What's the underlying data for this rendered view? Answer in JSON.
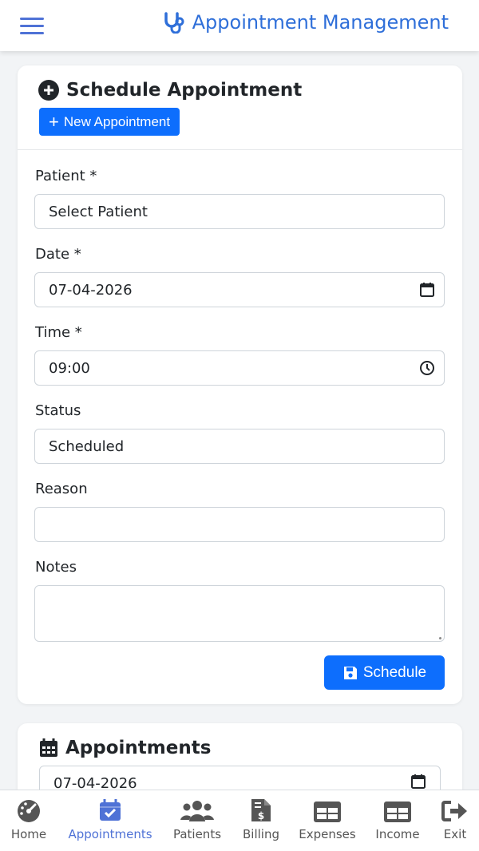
{
  "header": {
    "title": "Appointment Management"
  },
  "schedule_card": {
    "title": "Schedule Appointment",
    "new_button": "New Appointment",
    "fields": {
      "patient": {
        "label": "Patient *",
        "value": "Select Patient"
      },
      "date": {
        "label": "Date *",
        "value": "07-04-2026"
      },
      "time": {
        "label": "Time *",
        "value": "09:00"
      },
      "status": {
        "label": "Status",
        "value": "Scheduled"
      },
      "reason": {
        "label": "Reason",
        "value": ""
      },
      "notes": {
        "label": "Notes",
        "value": ""
      }
    },
    "submit_button": "Schedule"
  },
  "appointments_card": {
    "title": "Appointments",
    "date_filter": "07-04-2026"
  },
  "bottom_nav": {
    "items": [
      {
        "label": "Home",
        "icon": "gauge-icon",
        "active": false
      },
      {
        "label": "Appointments",
        "icon": "calendar-check-icon",
        "active": true
      },
      {
        "label": "Patients",
        "icon": "users-icon",
        "active": false
      },
      {
        "label": "Billing",
        "icon": "invoice-dollar-icon",
        "active": false
      },
      {
        "label": "Expenses",
        "icon": "table-icon",
        "active": false
      },
      {
        "label": "Income",
        "icon": "table-icon",
        "active": false
      },
      {
        "label": "Exit",
        "icon": "sign-out-icon",
        "active": false
      }
    ]
  },
  "colors": {
    "primary": "#0d6efd",
    "accent": "#4f72d6",
    "brand_text": "#2f6fd9",
    "nav_inactive": "#555555"
  }
}
